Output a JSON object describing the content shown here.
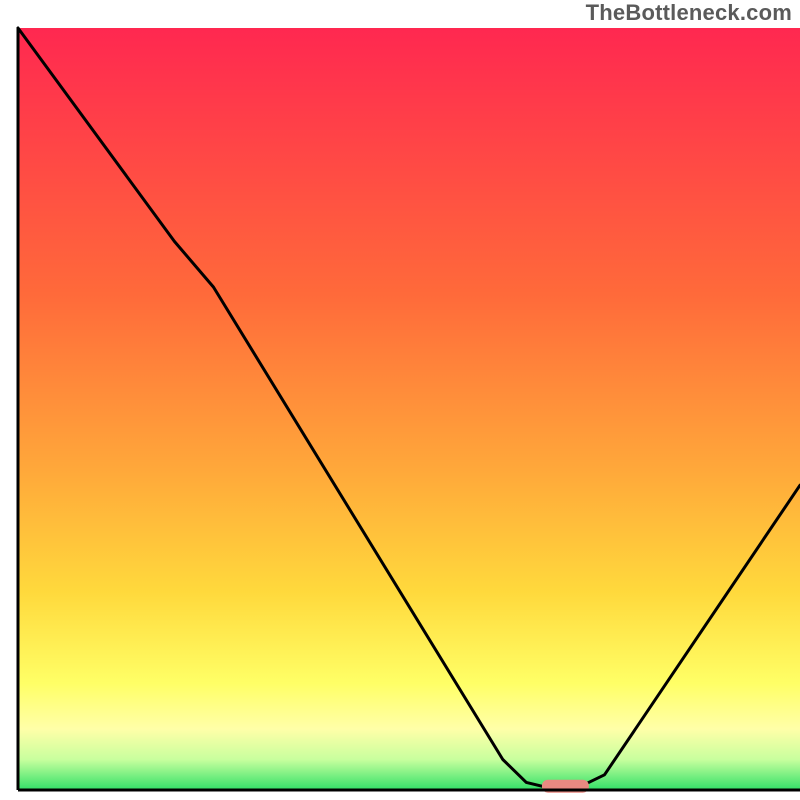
{
  "watermark": "TheBottleneck.com",
  "chart_data": {
    "type": "line",
    "title": "",
    "xlabel": "",
    "ylabel": "",
    "xlim": [
      0,
      100
    ],
    "ylim": [
      0,
      100
    ],
    "background_gradient_stops": [
      {
        "offset": 0,
        "color": "#ff2850"
      },
      {
        "offset": 35,
        "color": "#ff6a3a"
      },
      {
        "offset": 58,
        "color": "#ffa83a"
      },
      {
        "offset": 74,
        "color": "#ffd93c"
      },
      {
        "offset": 86,
        "color": "#ffff66"
      },
      {
        "offset": 92,
        "color": "#ffffa8"
      },
      {
        "offset": 96,
        "color": "#c8ff9e"
      },
      {
        "offset": 100,
        "color": "#32e068"
      }
    ],
    "curve_points": [
      {
        "x": 0,
        "y": 100
      },
      {
        "x": 20,
        "y": 72
      },
      {
        "x": 25,
        "y": 66
      },
      {
        "x": 62,
        "y": 4
      },
      {
        "x": 65,
        "y": 1
      },
      {
        "x": 67,
        "y": 0.5
      },
      {
        "x": 72,
        "y": 0.5
      },
      {
        "x": 75,
        "y": 2
      },
      {
        "x": 100,
        "y": 40
      }
    ],
    "marker": {
      "x_start": 67,
      "x_end": 73,
      "y": 0.5,
      "color": "#e88981"
    },
    "axis_color": "#000000",
    "axis_width": 3,
    "curve_color": "#000000",
    "curve_width": 3
  }
}
